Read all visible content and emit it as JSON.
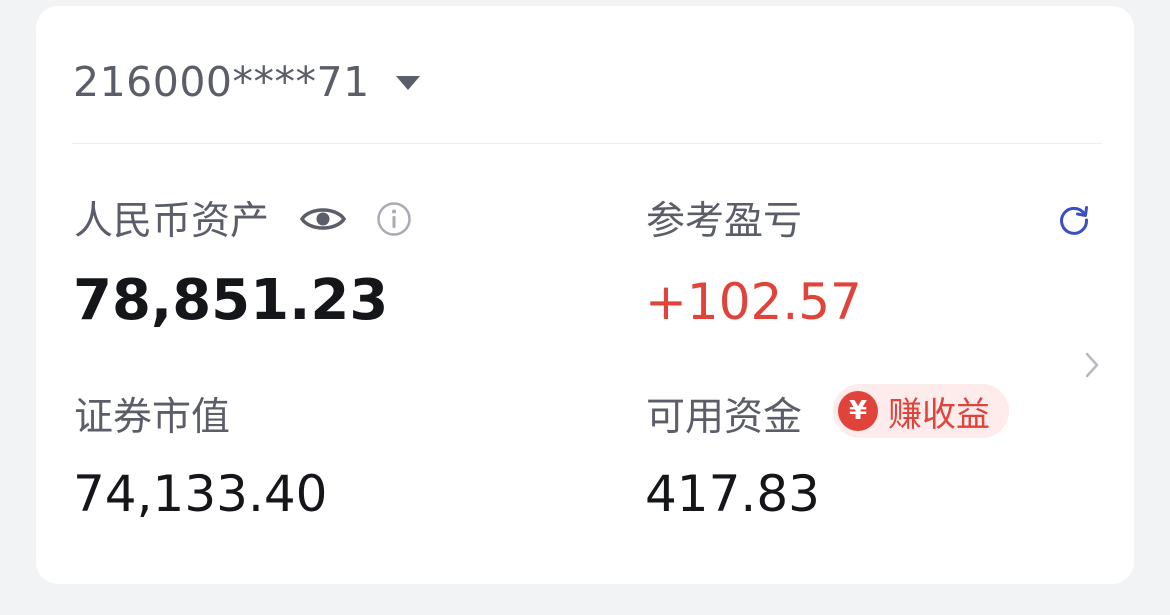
{
  "account": {
    "number": "216000****71"
  },
  "summary": {
    "total_assets_label": "人民币资产",
    "total_assets_value": "78,851.23",
    "pnl_label": "参考盈亏",
    "pnl_value": "+102.57",
    "securities_label": "证券市值",
    "securities_value": "74,133.40",
    "available_cash_label": "可用资金",
    "available_cash_value": "417.83"
  },
  "promo_badge": {
    "coin_symbol": "¥",
    "label": "赚收益"
  },
  "icons": [
    "eye-icon",
    "info-icon",
    "refresh-icon",
    "chevron-right-icon",
    "chevron-down-icon",
    "yuan-coin-icon"
  ],
  "colors": {
    "positive": "#e0433a",
    "accent": "#3b4fc4",
    "text_primary": "#15161a",
    "text_secondary": "#5b5d68"
  }
}
